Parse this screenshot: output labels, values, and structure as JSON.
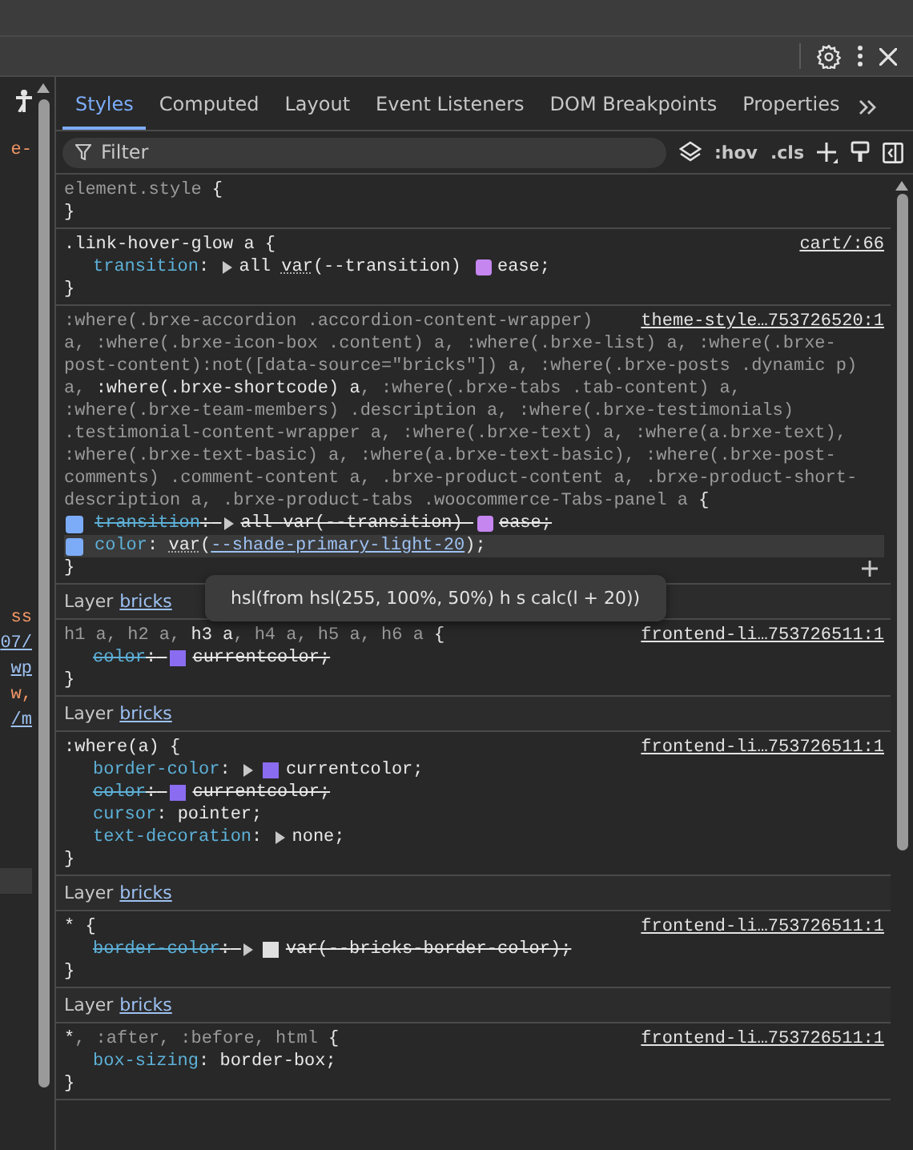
{
  "left_pane": {
    "groups": [
      [
        {
          "text": "e-",
          "kind": "string"
        }
      ],
      [
        {
          "text": "ss",
          "kind": "string"
        },
        {
          "text": "07/",
          "kind": "link"
        },
        {
          "text": "wp",
          "kind": "link"
        },
        {
          "text": "w,",
          "kind": "string"
        },
        {
          "text": "/m",
          "kind": "link"
        }
      ]
    ]
  },
  "tabs": [
    {
      "label": "Styles",
      "selected": true
    },
    {
      "label": "Computed",
      "selected": false
    },
    {
      "label": "Layout",
      "selected": false
    },
    {
      "label": "Event Listeners",
      "selected": false
    },
    {
      "label": "DOM Breakpoints",
      "selected": false
    },
    {
      "label": "Properties",
      "selected": false
    }
  ],
  "filter": {
    "placeholder": "Filter",
    "toggles": [
      ":hov",
      ".cls"
    ]
  },
  "sections": [
    {
      "kind": "rule",
      "selector_lines": [
        [
          {
            "text": "element.style",
            "matched": false
          },
          {
            "text": " {",
            "matched": true
          }
        ]
      ],
      "close": "}"
    },
    {
      "kind": "rule",
      "selector_lines": [
        [
          {
            "text": ".link-hover-glow a",
            "matched": true
          },
          {
            "text": " {",
            "matched": true
          }
        ]
      ],
      "source": "cart/:66",
      "close": "}",
      "declarations": [
        {
          "property": "transition",
          "colon": ":",
          "struck": false,
          "highlighted": false,
          "parts": [
            {
              "kind": "arrow"
            },
            {
              "kind": "text",
              "text": "all "
            },
            {
              "kind": "var",
              "text": "var"
            },
            {
              "kind": "text",
              "text": "(--transition) "
            },
            {
              "kind": "easing"
            },
            {
              "kind": "text",
              "text": "ease;"
            }
          ]
        }
      ]
    },
    {
      "kind": "rule",
      "selector_lines": [
        [
          {
            "text": ":where(.brxe-accordion .accordion-content-wrapper)",
            "matched": false
          }
        ],
        [
          {
            "text": "a, :where(.brxe-icon-box .content) a, :where(.brxe-list) a, :where(.brxe-post-content):not([data-source=\"bricks\"]) a, :where(.brxe-posts .dynamic p) a, ",
            "matched": false
          },
          {
            "text": ":where(.brxe-shortcode) a",
            "matched": true
          },
          {
            "text": ", :where(.brxe-tabs .tab-content) a, :where(.brxe-team-members) .description a, :where(.brxe-testimonials) .testimonial-content-wrapper a, :where(.brxe-text) a, :where(a.brxe-text), :where(.brxe-text-basic) a, :where(a.brxe-text-basic), :where(.brxe-post-comments) .comment-content a, .brxe-product-content a, .brxe-product-short-description a, .brxe-product-tabs .woocommerce-Tabs-panel a",
            "matched": false
          },
          {
            "text": " {",
            "matched": true
          }
        ]
      ],
      "source": "theme-style…753726520:1",
      "close": "}",
      "declarations": [
        {
          "property": "transition",
          "colon": ":",
          "struck": true,
          "highlighted": false,
          "checked": true,
          "parts": [
            {
              "kind": "arrow"
            },
            {
              "kind": "text",
              "text": "all "
            },
            {
              "kind": "var",
              "text": "var"
            },
            {
              "kind": "text",
              "text": "(--transition) "
            },
            {
              "kind": "easing"
            },
            {
              "kind": "text",
              "text": "ease;"
            }
          ]
        },
        {
          "property": "color",
          "colon": ":",
          "struck": false,
          "highlighted": true,
          "checked": true,
          "parts": [
            {
              "kind": "var",
              "text": "var"
            },
            {
              "kind": "text",
              "text": "("
            },
            {
              "kind": "link",
              "text": "--shade-primary-light-20"
            },
            {
              "kind": "text",
              "text": ");"
            }
          ]
        }
      ],
      "tooltip": "hsl(from hsl(255, 100%, 50%) h s calc(l + 20))"
    },
    {
      "kind": "layer",
      "label": "Layer",
      "link": "bricks"
    },
    {
      "kind": "rule",
      "selector_lines": [
        [
          {
            "text": "h1 a, h2 a, ",
            "matched": false
          },
          {
            "text": "h3 a",
            "matched": true
          },
          {
            "text": ", h4 a, h5 a, h6 a",
            "matched": false
          },
          {
            "text": " {",
            "matched": true
          }
        ]
      ],
      "source": "frontend-li…753726511:1",
      "close": "}",
      "declarations": [
        {
          "property": "color",
          "colon": ":",
          "struck": true,
          "highlighted": false,
          "parts": [
            {
              "kind": "swatch",
              "color": "#8a6cf0"
            },
            {
              "kind": "text",
              "text": "currentcolor;"
            }
          ]
        }
      ]
    },
    {
      "kind": "layer",
      "label": "Layer",
      "link": "bricks"
    },
    {
      "kind": "rule",
      "selector_lines": [
        [
          {
            "text": ":where(a)",
            "matched": true
          },
          {
            "text": " {",
            "matched": true
          }
        ]
      ],
      "source": "frontend-li…753726511:1",
      "close": "}",
      "declarations": [
        {
          "property": "border-color",
          "colon": ":",
          "struck": false,
          "highlighted": false,
          "parts": [
            {
              "kind": "arrow"
            },
            {
              "kind": "swatch",
              "color": "#8a6cf0"
            },
            {
              "kind": "text",
              "text": "currentcolor;"
            }
          ]
        },
        {
          "property": "color",
          "colon": ":",
          "struck": true,
          "highlighted": false,
          "parts": [
            {
              "kind": "swatch",
              "color": "#8a6cf0"
            },
            {
              "kind": "text",
              "text": "currentcolor;"
            }
          ]
        },
        {
          "property": "cursor",
          "colon": ":",
          "struck": false,
          "highlighted": false,
          "parts": [
            {
              "kind": "text",
              "text": "pointer;"
            }
          ]
        },
        {
          "property": "text-decoration",
          "colon": ":",
          "struck": false,
          "highlighted": false,
          "parts": [
            {
              "kind": "arrow"
            },
            {
              "kind": "text",
              "text": "none;"
            }
          ]
        }
      ]
    },
    {
      "kind": "layer",
      "label": "Layer",
      "link": "bricks"
    },
    {
      "kind": "rule",
      "selector_lines": [
        [
          {
            "text": "*",
            "matched": true
          },
          {
            "text": " {",
            "matched": true
          }
        ]
      ],
      "source": "frontend-li…753726511:1",
      "close": "}",
      "declarations": [
        {
          "property": "border-color",
          "colon": ":",
          "struck": true,
          "highlighted": false,
          "parts": [
            {
              "kind": "arrow"
            },
            {
              "kind": "swatch",
              "color": "#e0e0e0"
            },
            {
              "kind": "var",
              "text": "var"
            },
            {
              "kind": "text",
              "text": "(--bricks-border-color);"
            }
          ]
        }
      ]
    },
    {
      "kind": "layer",
      "label": "Layer",
      "link": "bricks"
    },
    {
      "kind": "rule",
      "selector_lines": [
        [
          {
            "text": "*",
            "matched": true
          },
          {
            "text": ", :after, :before, html",
            "matched": false
          },
          {
            "text": " {",
            "matched": true
          }
        ]
      ],
      "source": "frontend-li…753726511:1",
      "close": "}",
      "declarations": [
        {
          "property": "box-sizing",
          "colon": ":",
          "struck": false,
          "highlighted": false,
          "parts": [
            {
              "kind": "text",
              "text": "border-box;"
            }
          ]
        }
      ]
    }
  ]
}
